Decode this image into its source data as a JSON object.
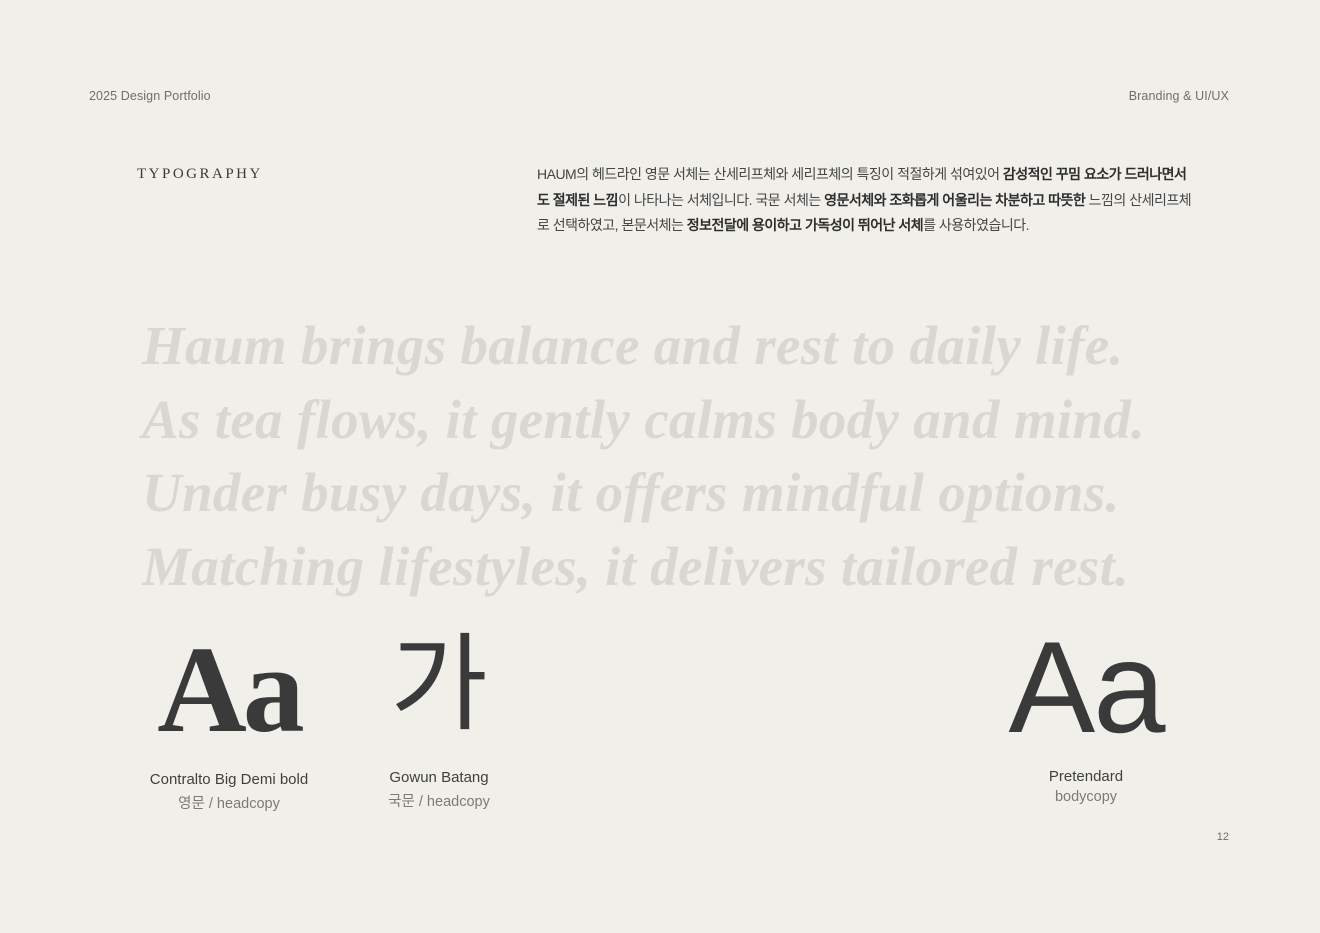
{
  "header": {
    "left": "2025 Design Portfolio",
    "right": "Branding  &  UI/UX"
  },
  "section": {
    "title": "TYPOGRAPHY"
  },
  "description": {
    "parts": [
      {
        "text": "HAUM의 헤드라인 영문 서체는 산세리프체와 세리프체의 특징이 적절하게 섞여있어 ",
        "bold": false
      },
      {
        "text": "감성적인 꾸밈 요소가 드러나면서도 절제된 느낌",
        "bold": true
      },
      {
        "text": "이 나타나는 서체입니다. 국문 서체는 ",
        "bold": false
      },
      {
        "text": "영문서체와 조화롭게 어울리는 차분하고 따뜻한",
        "bold": true
      },
      {
        "text": " 느낌의 산세리프체로 선택하였고, 본문서체는 ",
        "bold": false
      },
      {
        "text": "정보전달에 용이하고 가독성이 뛰어난 서체",
        "bold": true
      },
      {
        "text": "를 사용하였습니다.",
        "bold": false
      }
    ]
  },
  "sample_lines": [
    "Haum brings balance and rest to daily life.",
    "As tea flows, it gently calms body and mind.",
    "Under busy days, it offers mindful options.",
    "Matching lifestyles, it delivers tailored rest."
  ],
  "specimens": [
    {
      "glyph": "Aa",
      "name": "Contralto Big Demi bold",
      "usage": "영문 / headcopy"
    },
    {
      "glyph": "가",
      "name": "Gowun Batang",
      "usage": "국문 / headcopy"
    },
    {
      "glyph": "Aa",
      "name": "Pretendard",
      "usage": "bodycopy"
    }
  ],
  "page_number": "12",
  "colors": {
    "background": "#f0efea",
    "text": "#3a3a3a",
    "sample_text": "#d8d7d2"
  }
}
